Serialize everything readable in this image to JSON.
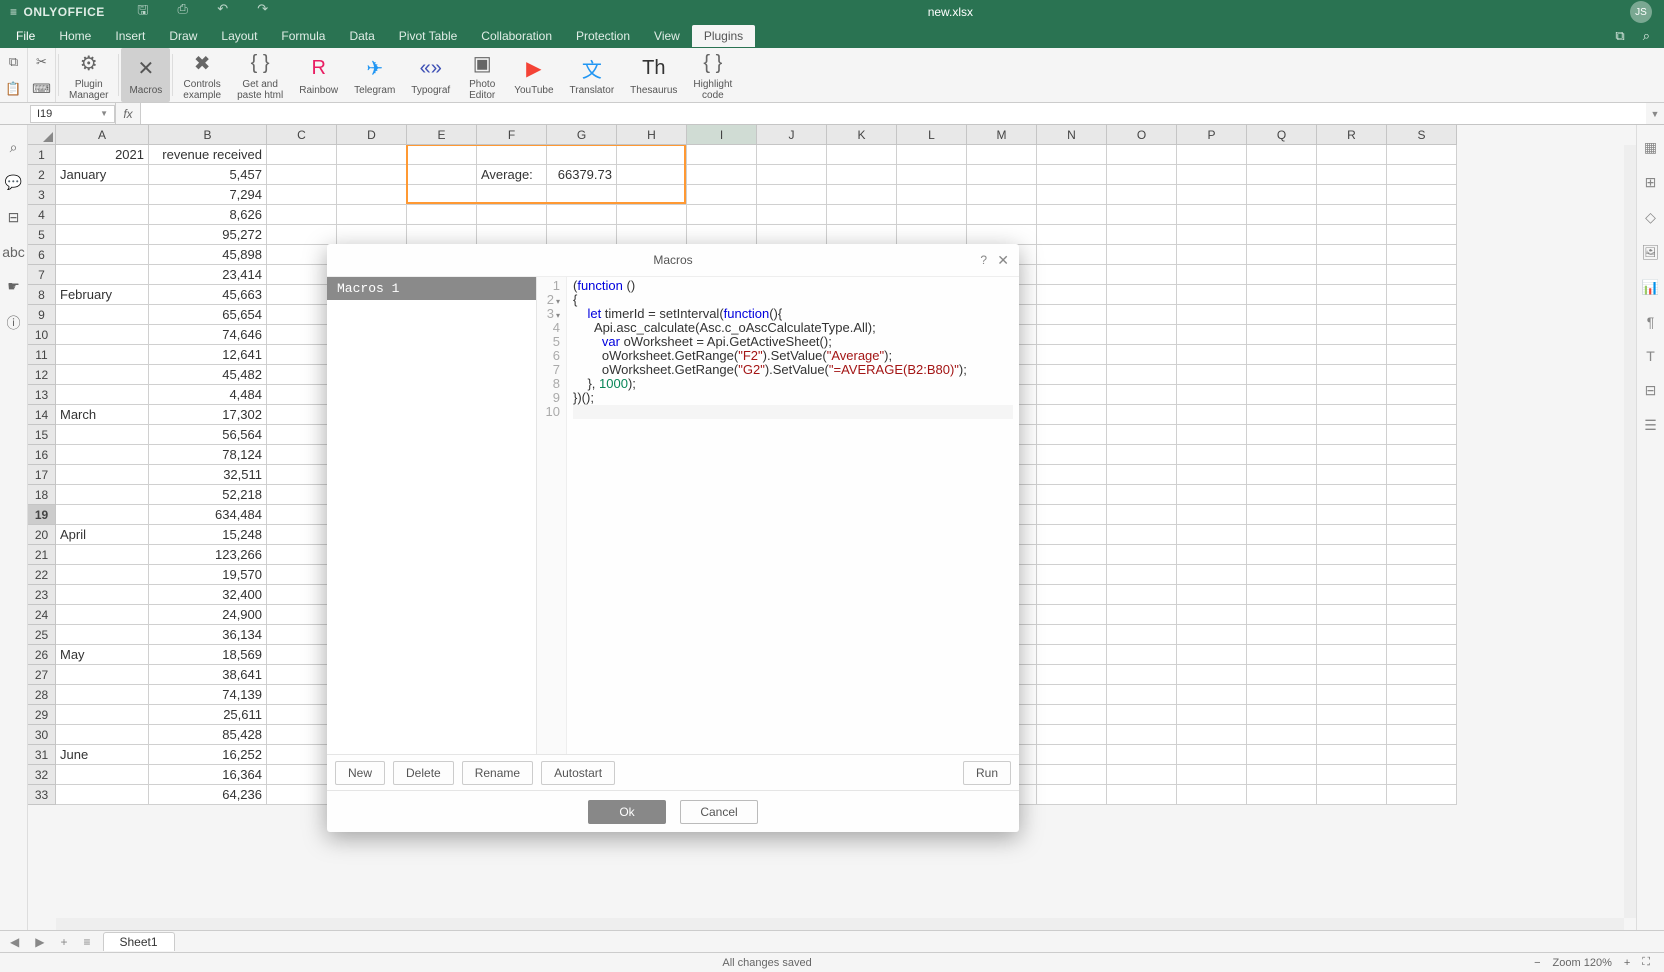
{
  "titlebar": {
    "brand": "ONLYOFFICE",
    "filename": "new.xlsx",
    "user": "JS"
  },
  "menu": {
    "tabs": [
      "File",
      "Home",
      "Insert",
      "Draw",
      "Layout",
      "Formula",
      "Data",
      "Pivot Table",
      "Collaboration",
      "Protection",
      "View",
      "Plugins"
    ],
    "active": "Plugins"
  },
  "ribbon": {
    "plugins": [
      {
        "label": "Plugin\nManager",
        "icon": "⚙",
        "color": "#666"
      },
      {
        "label": "Macros",
        "icon": "✕",
        "sel": true,
        "color": "#555"
      },
      {
        "label": "Controls\nexample",
        "icon": "✖",
        "color": "#666"
      },
      {
        "label": "Get and\npaste html",
        "icon": "{ }",
        "color": "#666"
      },
      {
        "label": "Rainbow",
        "icon": "R",
        "color": "#e91e63"
      },
      {
        "label": "Telegram",
        "icon": "✈",
        "color": "#2196f3"
      },
      {
        "label": "Typograf",
        "icon": "«»",
        "color": "#3f51b5"
      },
      {
        "label": "Photo\nEditor",
        "icon": "▣",
        "color": "#666"
      },
      {
        "label": "YouTube",
        "icon": "▶",
        "color": "#f44336"
      },
      {
        "label": "Translator",
        "icon": "文",
        "color": "#2196f3"
      },
      {
        "label": "Thesaurus",
        "icon": "Th",
        "color": "#333"
      },
      {
        "label": "Highlight\ncode",
        "icon": "{ }",
        "color": "#666"
      }
    ]
  },
  "namebox": "I19",
  "columns": [
    "A",
    "B",
    "C",
    "D",
    "E",
    "F",
    "G",
    "H",
    "I",
    "J",
    "K",
    "L",
    "M",
    "N",
    "O",
    "P",
    "Q",
    "R",
    "S"
  ],
  "colWidths": {
    "A": 93,
    "B": 118,
    "default": 70
  },
  "rows": 33,
  "selectedCol": "I",
  "selectedRow": 19,
  "cells": {
    "A1": "2021",
    "B1": "revenue received",
    "A2": "January",
    "B2": "5,457",
    "B3": "7,294",
    "B4": "8,626",
    "B5": "95,272",
    "B6": "45,898",
    "B7": "23,414",
    "A8": "February",
    "B8": "45,663",
    "B9": "65,654",
    "B10": "74,646",
    "B11": "12,641",
    "B12": "45,482",
    "B13": "4,484",
    "A14": "March",
    "B14": "17,302",
    "B15": "56,564",
    "B16": "78,124",
    "B17": "32,511",
    "B18": "52,218",
    "B19": "634,484",
    "A20": "April",
    "B20": "15,248",
    "B21": "123,266",
    "B22": "19,570",
    "B23": "32,400",
    "B24": "24,900",
    "B25": "36,134",
    "A26": "May",
    "B26": "18,569",
    "B27": "38,641",
    "B28": "74,139",
    "B29": "25,611",
    "B30": "85,428",
    "A31": "June",
    "B31": "16,252",
    "B32": "16,364",
    "B33": "64,236",
    "F2": "Average:",
    "G2": "66379.73"
  },
  "highlight": {
    "cols": [
      "E",
      "F",
      "G",
      "H"
    ],
    "rows": [
      1,
      2,
      3
    ]
  },
  "sheet": {
    "active": "Sheet1"
  },
  "status": {
    "text": "All changes saved",
    "zoom": "Zoom 120%"
  },
  "modal": {
    "title": "Macros",
    "listItem": "Macros 1",
    "actions": {
      "new": "New",
      "delete": "Delete",
      "rename": "Rename",
      "autostart": "Autostart",
      "run": "Run"
    },
    "footer": {
      "ok": "Ok",
      "cancel": "Cancel"
    },
    "code": {
      "l1a": "(",
      "l1b": "function",
      "l1c": " ()",
      "l2": "{",
      "l3a": "    ",
      "l3b": "let",
      "l3c": " timerId = setInterval(",
      "l3d": "function",
      "l3e": "(){",
      "l4": "      Api.asc_calculate(Asc.c_oAscCalculateType.All);",
      "l5a": "        ",
      "l5b": "var",
      "l5c": " oWorksheet = Api.GetActiveSheet();",
      "l6a": "        oWorksheet.GetRange(",
      "l6b": "\"F2\"",
      "l6c": ").SetValue(",
      "l6d": "\"Average\"",
      "l6e": ");",
      "l7a": "        oWorksheet.GetRange(",
      "l7b": "\"G2\"",
      "l7c": ").SetValue(",
      "l7d": "\"=AVERAGE(B2:B80)\"",
      "l7e": ");",
      "l8a": "    }, ",
      "l8b": "1000",
      "l8c": ");",
      "l9": "})();"
    }
  }
}
